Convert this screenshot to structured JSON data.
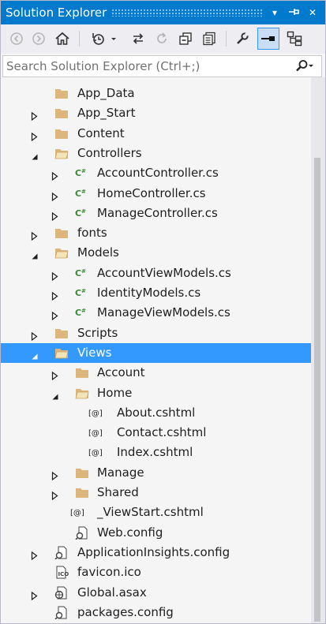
{
  "window": {
    "title": "Solution Explorer"
  },
  "titlebar_buttons": [
    {
      "name": "dropdown-icon",
      "glyph": "▾"
    },
    {
      "name": "pin-icon",
      "glyph": "⊣"
    },
    {
      "name": "close-icon",
      "glyph": "✕"
    }
  ],
  "toolbar": {
    "buttons": [
      "back-icon",
      "forward-icon",
      "home-icon",
      "history-icon",
      "sync-icon",
      "refresh-icon",
      "collapse-all-icon",
      "show-all-files-icon",
      "properties-icon",
      "pin-preview-icon",
      "class-view-icon"
    ],
    "active": "pin-preview-icon"
  },
  "search": {
    "placeholder": "Search Solution Explorer (Ctrl+;)"
  },
  "tree": {
    "items": [
      {
        "label": "App_Data",
        "icon": "folder-icon",
        "arrow": "none",
        "depth": 1
      },
      {
        "label": "App_Start",
        "icon": "folder-icon",
        "arrow": "collapsed",
        "depth": 1
      },
      {
        "label": "Content",
        "icon": "folder-icon",
        "arrow": "collapsed",
        "depth": 1
      },
      {
        "label": "Controllers",
        "icon": "folder-open-icon",
        "arrow": "expanded",
        "depth": 1
      },
      {
        "label": "AccountController.cs",
        "icon": "csharp-file-icon",
        "arrow": "collapsed",
        "depth": 2
      },
      {
        "label": "HomeController.cs",
        "icon": "csharp-file-icon",
        "arrow": "collapsed",
        "depth": 2
      },
      {
        "label": "ManageController.cs",
        "icon": "csharp-file-icon",
        "arrow": "collapsed",
        "depth": 2
      },
      {
        "label": "fonts",
        "icon": "folder-icon",
        "arrow": "collapsed",
        "depth": 1
      },
      {
        "label": "Models",
        "icon": "folder-open-icon",
        "arrow": "expanded",
        "depth": 1
      },
      {
        "label": "AccountViewModels.cs",
        "icon": "csharp-file-icon",
        "arrow": "collapsed",
        "depth": 2
      },
      {
        "label": "IdentityModels.cs",
        "icon": "csharp-file-icon",
        "arrow": "collapsed",
        "depth": 2
      },
      {
        "label": "ManageViewModels.cs",
        "icon": "csharp-file-icon",
        "arrow": "collapsed",
        "depth": 2
      },
      {
        "label": "Scripts",
        "icon": "folder-icon",
        "arrow": "collapsed",
        "depth": 1
      },
      {
        "label": "Views",
        "icon": "folder-open-icon",
        "arrow": "expanded",
        "depth": 1,
        "selected": true
      },
      {
        "label": "Account",
        "icon": "folder-icon",
        "arrow": "collapsed",
        "depth": 2
      },
      {
        "label": "Home",
        "icon": "folder-open-icon",
        "arrow": "expanded",
        "depth": 2
      },
      {
        "label": "About.cshtml",
        "icon": "razor-file-icon",
        "arrow": "none",
        "depth": 3
      },
      {
        "label": "Contact.cshtml",
        "icon": "razor-file-icon",
        "arrow": "none",
        "depth": 3
      },
      {
        "label": "Index.cshtml",
        "icon": "razor-file-icon",
        "arrow": "none",
        "depth": 3
      },
      {
        "label": "Manage",
        "icon": "folder-icon",
        "arrow": "collapsed",
        "depth": 2
      },
      {
        "label": "Shared",
        "icon": "folder-icon",
        "arrow": "collapsed",
        "depth": 2
      },
      {
        "label": "_ViewStart.cshtml",
        "icon": "razor-file-icon",
        "arrow": "none",
        "depth": 2
      },
      {
        "label": "Web.config",
        "icon": "config-file-icon",
        "arrow": "none",
        "depth": 2
      },
      {
        "label": "ApplicationInsights.config",
        "icon": "config-file-icon",
        "arrow": "collapsed",
        "depth": 1
      },
      {
        "label": "favicon.ico",
        "icon": "ico-file-icon",
        "arrow": "none",
        "depth": 1
      },
      {
        "label": "Global.asax",
        "icon": "asax-file-icon",
        "arrow": "collapsed",
        "depth": 1
      },
      {
        "label": "packages.config",
        "icon": "config-file-icon",
        "arrow": "none",
        "depth": 1
      }
    ]
  },
  "colors": {
    "accent": "#007acc",
    "selection": "#3399ff",
    "folder": "#dcb67a",
    "csharp": "#388a34"
  }
}
